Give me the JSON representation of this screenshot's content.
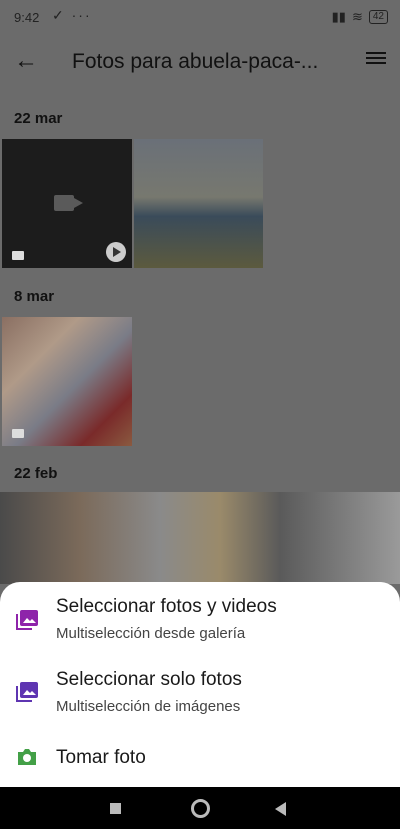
{
  "status_bar": {
    "time": "9:42",
    "left_icons": "✓ ···",
    "battery": "42"
  },
  "appbar": {
    "title": "Fotos para abuela-paca-...",
    "back_icon": "arrow-left-icon",
    "menu_icon": "list-icon"
  },
  "sections": [
    {
      "date": "22 mar"
    },
    {
      "date": "8 mar"
    },
    {
      "date": "22 feb"
    }
  ],
  "sheet": {
    "items": [
      {
        "title": "Seleccionar fotos y videos",
        "subtitle": "Multiselección desde galería",
        "icon": "photo-library-icon",
        "color": "#8e24aa"
      },
      {
        "title": "Seleccionar solo fotos",
        "subtitle": "Multiselección de imágenes",
        "icon": "photo-library-icon",
        "color": "#5e35b1"
      },
      {
        "title": "Tomar foto",
        "icon": "camera-icon",
        "color": "#43a047"
      }
    ]
  }
}
